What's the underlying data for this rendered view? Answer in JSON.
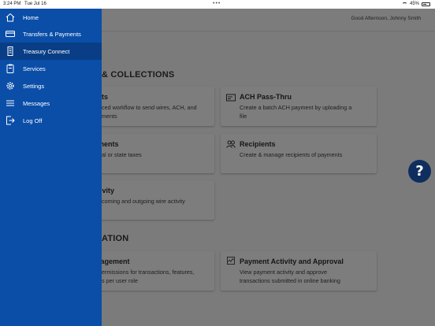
{
  "status_bar": {
    "time": "3:24 PM",
    "date": "Tue Jul 16",
    "battery": "45%"
  },
  "header": {
    "greeting": "Good Afternoon, Johnny Smith"
  },
  "sections": {
    "payments": {
      "title": "& COLLECTIONS"
    },
    "administration": {
      "title": "ATION"
    }
  },
  "cards": {
    "payments": {
      "title": "ts",
      "desc1": "ced workflow to send wires, ACH, and",
      "desc2": "ments"
    },
    "ach_pass_thru": {
      "title": "ACH Pass-Thru",
      "desc1": "Create a batch ACH payment by uploading a",
      "desc2": "file"
    },
    "tax_payments": {
      "title": "ments",
      "desc1": "al or state taxes"
    },
    "recipients": {
      "title": "Recipients",
      "desc1": "Create & manage recipients of payments"
    },
    "wire_activity": {
      "title": "tivity",
      "desc1": "coming and outgoing wire activity"
    },
    "user_management": {
      "title": "anagement",
      "desc1": "ermissions for transactions, features,",
      "desc2": "s per user role"
    },
    "payment_activity": {
      "title": "Payment Activity and Approval",
      "desc1": "View payment activity and approve",
      "desc2": "transactions submitted in online banking"
    }
  },
  "help": {
    "label": "?"
  },
  "drawer": {
    "items": [
      {
        "label": "Home",
        "icon": "home-icon"
      },
      {
        "label": "Transfers & Payments",
        "icon": "credit-card-icon"
      },
      {
        "label": "Treasury Connect",
        "icon": "building-icon",
        "active": true
      },
      {
        "label": "Services",
        "icon": "clipboard-icon"
      },
      {
        "label": "Settings",
        "icon": "gear-icon"
      },
      {
        "label": "Messages",
        "icon": "menu-lines-icon"
      },
      {
        "label": "Log Off",
        "icon": "logout-icon"
      }
    ]
  },
  "colors": {
    "drawer_bg": "#0a4ea8",
    "drawer_active": "#093e86",
    "overlay_bg": "#7b7b7b",
    "help_button": "#0f2e5e"
  }
}
